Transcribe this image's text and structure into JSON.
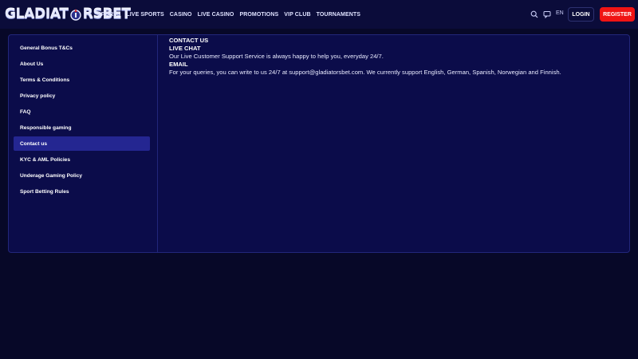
{
  "header": {
    "logo_text_left": "GLADIAT",
    "logo_text_right": "RSBET",
    "nav": [
      "SPORTS",
      "LIVE SPORTS",
      "CASINO",
      "LIVE CASINO",
      "PROMOTIONS",
      "VIP CLUB",
      "TOURNAMENTS"
    ],
    "language": "EN",
    "login_label": "LOGIN",
    "register_label": "REGISTER",
    "icons": [
      "search-icon",
      "chat-icon"
    ]
  },
  "sidebar": {
    "items": [
      {
        "label": "General Bonus T&Cs"
      },
      {
        "label": "About Us"
      },
      {
        "label": "Terms & Conditions"
      },
      {
        "label": "Privacy policy"
      },
      {
        "label": "FAQ"
      },
      {
        "label": "Responsible gaming"
      },
      {
        "label": "Contact us",
        "active": true
      },
      {
        "label": "KYC & AML Policies"
      },
      {
        "label": "Underage Gaming Policy"
      },
      {
        "label": "Sport Betting Rules"
      }
    ]
  },
  "main": {
    "title": "CONTACT US",
    "live_chat_heading": "LIVE CHAT",
    "live_chat_text": "Our Live Customer Support Service is always happy to help you, everyday 24/7.",
    "email_heading": "EMAIL",
    "email_text": "For your queries, you can write to us 24/7 at support@gladiatorsbet.com. We currently support English, German, Spanish, Norwegian and Finnish."
  },
  "colors": {
    "page_bg": "#070828",
    "header_bg": "#0b0c3a",
    "panel_bg": "#0b0c4a",
    "active_item": "#242691",
    "register_red": "#f01414"
  }
}
